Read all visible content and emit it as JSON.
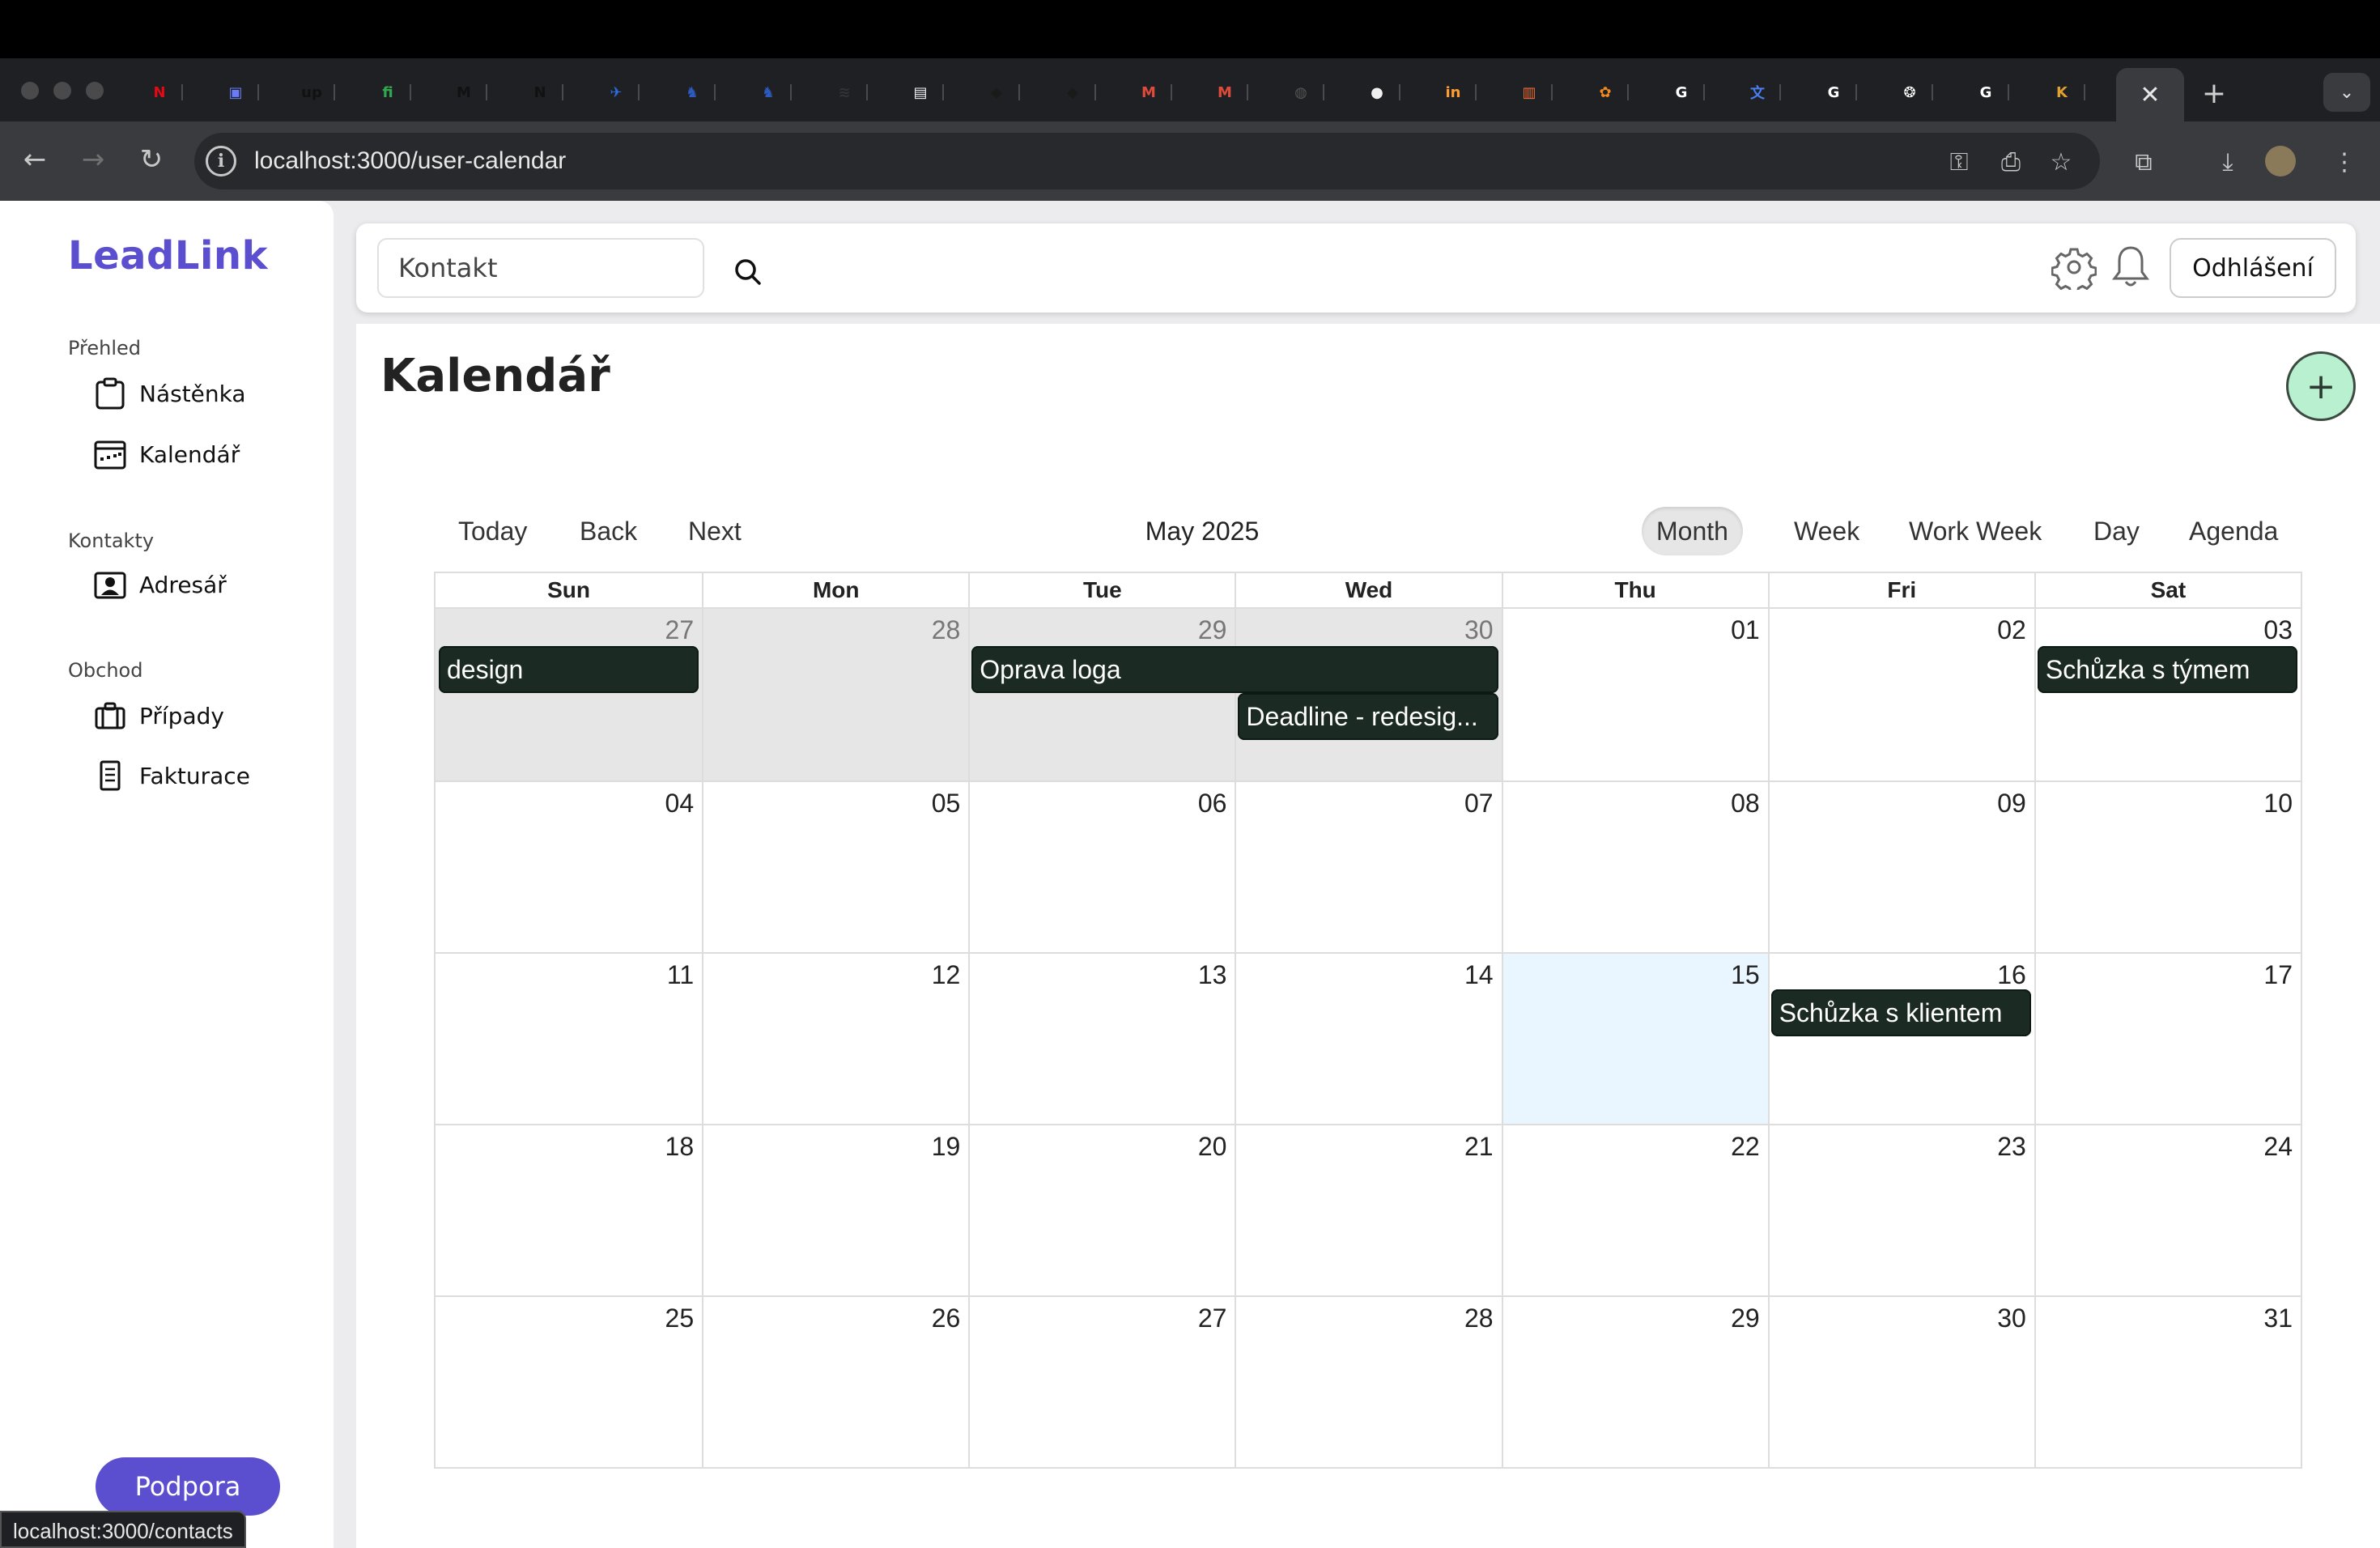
{
  "browser": {
    "url": "localhost:3000/user-calendar",
    "status_url": "localhost:3000/contacts",
    "active_tab_close": "✕",
    "new_tab": "+",
    "tab_menu": "⌄",
    "tabs": [
      {
        "icon": "netflix-icon",
        "glyph": "N",
        "color": "#e50914"
      },
      {
        "icon": "printer-icon",
        "glyph": "▣",
        "color": "#6a7cf5"
      },
      {
        "icon": "upwork-icon",
        "glyph": "up",
        "color": "#111111"
      },
      {
        "icon": "fi-icon",
        "glyph": "fi",
        "color": "#2fa84f"
      },
      {
        "icon": "medium-icon",
        "glyph": "M",
        "color": "#111111"
      },
      {
        "icon": "n-logo-icon",
        "glyph": "N",
        "color": "#111111"
      },
      {
        "icon": "bird-icon",
        "glyph": "✈",
        "color": "#2d6cdf"
      },
      {
        "icon": "lion-icon",
        "glyph": "♞",
        "color": "#2d5bbf"
      },
      {
        "icon": "lion-icon",
        "glyph": "♞",
        "color": "#2d5bbf"
      },
      {
        "icon": "car-icon",
        "glyph": "≋",
        "color": "#333333"
      },
      {
        "icon": "book-icon",
        "glyph": "▤",
        "color": "#f2f2f2"
      },
      {
        "icon": "cube-icon",
        "glyph": "◆",
        "color": "#1a1a1a"
      },
      {
        "icon": "cube-icon",
        "glyph": "◆",
        "color": "#1a1a1a"
      },
      {
        "icon": "gmail-icon",
        "glyph": "M",
        "color": "#e04a3a"
      },
      {
        "icon": "gmail-icon",
        "glyph": "M",
        "color": "#e04a3a"
      },
      {
        "icon": "globe-icon",
        "glyph": "◍",
        "color": "#555555"
      },
      {
        "icon": "github-icon",
        "glyph": "●",
        "color": "#f0f0f0"
      },
      {
        "icon": "invision-icon",
        "glyph": "in",
        "color": "#ff9d2e"
      },
      {
        "icon": "trello-icon",
        "glyph": "▥",
        "color": "#f06b34"
      },
      {
        "icon": "cluster-icon",
        "glyph": "✿",
        "color": "#f08a1e"
      },
      {
        "icon": "google-icon",
        "glyph": "G",
        "color": "#ffffff"
      },
      {
        "icon": "translate-icon",
        "glyph": "文",
        "color": "#4a7df0"
      },
      {
        "icon": "google-icon",
        "glyph": "G",
        "color": "#ffffff"
      },
      {
        "icon": "openai-icon",
        "glyph": "❂",
        "color": "#ffffff"
      },
      {
        "icon": "google-icon",
        "glyph": "G",
        "color": "#ffffff"
      },
      {
        "icon": "k-icon",
        "glyph": "K",
        "color": "#e0a030"
      }
    ]
  },
  "sidebar": {
    "logo": "LeadLink",
    "sections": [
      {
        "title": "Přehled",
        "items": [
          {
            "label": "Nástěnka",
            "icon": "clipboard-icon"
          },
          {
            "label": "Kalendář",
            "icon": "calendar-icon"
          }
        ]
      },
      {
        "title": "Kontakty",
        "items": [
          {
            "label": "Adresář",
            "icon": "address-book-icon"
          }
        ]
      },
      {
        "title": "Obchod",
        "items": [
          {
            "label": "Případy",
            "icon": "briefcase-icon"
          },
          {
            "label": "Fakturace",
            "icon": "invoice-icon"
          }
        ]
      }
    ],
    "support_label": "Podpora"
  },
  "header": {
    "search_placeholder": "Kontakt",
    "logout_label": "Odhlášení"
  },
  "page": {
    "title": "Kalendář",
    "add_label": "+"
  },
  "calendar": {
    "nav": {
      "today": "Today",
      "back": "Back",
      "next": "Next"
    },
    "month_label": "May 2025",
    "views": [
      "Month",
      "Week",
      "Work Week",
      "Day",
      "Agenda"
    ],
    "active_view": "Month",
    "weekdays": [
      "Sun",
      "Mon",
      "Tue",
      "Wed",
      "Thu",
      "Fri",
      "Sat"
    ],
    "weeks": [
      [
        {
          "d": "27",
          "off": true
        },
        {
          "d": "28",
          "off": true
        },
        {
          "d": "29",
          "off": true
        },
        {
          "d": "30",
          "off": true
        },
        {
          "d": "01"
        },
        {
          "d": "02"
        },
        {
          "d": "03"
        }
      ],
      [
        {
          "d": "04"
        },
        {
          "d": "05"
        },
        {
          "d": "06"
        },
        {
          "d": "07"
        },
        {
          "d": "08"
        },
        {
          "d": "09"
        },
        {
          "d": "10"
        }
      ],
      [
        {
          "d": "11"
        },
        {
          "d": "12"
        },
        {
          "d": "13"
        },
        {
          "d": "14"
        },
        {
          "d": "15",
          "today": true
        },
        {
          "d": "16"
        },
        {
          "d": "17"
        }
      ],
      [
        {
          "d": "18"
        },
        {
          "d": "19"
        },
        {
          "d": "20"
        },
        {
          "d": "21"
        },
        {
          "d": "22"
        },
        {
          "d": "23"
        },
        {
          "d": "24"
        }
      ],
      [
        {
          "d": "25"
        },
        {
          "d": "26"
        },
        {
          "d": "27"
        },
        {
          "d": "28"
        },
        {
          "d": "29"
        },
        {
          "d": "30"
        },
        {
          "d": "31"
        }
      ]
    ],
    "events": [
      {
        "title": "design",
        "week": 0,
        "start": 0,
        "span": 1,
        "slot": 0
      },
      {
        "title": "Oprava loga",
        "week": 0,
        "start": 2,
        "span": 2,
        "slot": 0
      },
      {
        "title": "Deadline - redesig...",
        "week": 0,
        "start": 3,
        "span": 1,
        "slot": 1
      },
      {
        "title": "Schůzka s týmem",
        "week": 0,
        "start": 6,
        "span": 1,
        "slot": 0
      },
      {
        "title": "Schůzka s klientem",
        "week": 2,
        "start": 5,
        "span": 1,
        "slot": 0
      }
    ]
  }
}
